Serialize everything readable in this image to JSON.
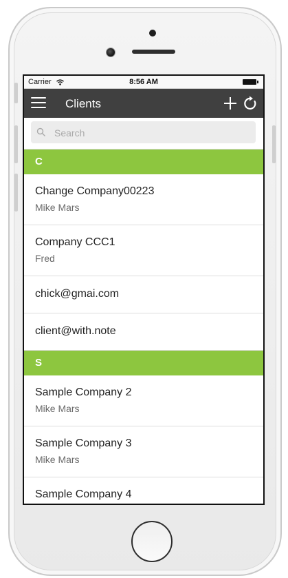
{
  "status_bar": {
    "carrier": "Carrier",
    "time": "8:56 AM"
  },
  "nav": {
    "title": "Clients"
  },
  "search": {
    "placeholder": "Search"
  },
  "sections": [
    {
      "header": "C",
      "items": [
        {
          "title": "Change Company00223",
          "subtitle": "Mike Mars"
        },
        {
          "title": "Company CCC1",
          "subtitle": "Fred"
        },
        {
          "title": "chick@gmai.com",
          "subtitle": ""
        },
        {
          "title": "client@with.note",
          "subtitle": ""
        }
      ]
    },
    {
      "header": "S",
      "items": [
        {
          "title": "Sample Company 2",
          "subtitle": "Mike Mars"
        },
        {
          "title": "Sample Company 3",
          "subtitle": "Mike Mars"
        },
        {
          "title": "Sample Company 4",
          "subtitle": ""
        }
      ]
    }
  ],
  "colors": {
    "nav_bg": "#404040",
    "section_header_bg": "#8dc63f"
  }
}
